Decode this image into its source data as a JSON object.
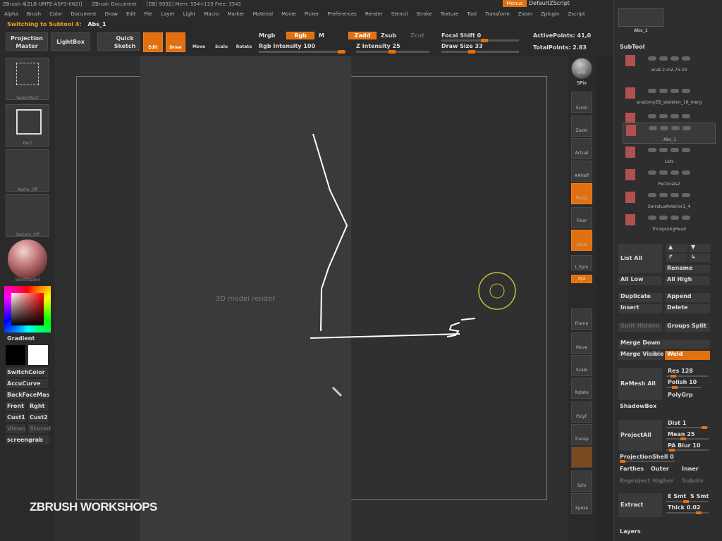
{
  "titlebar": {
    "app": "ZBrush 4[ZLB-UMTE-A5P3-KN2I]",
    "doc": "ZBrush Document",
    "mem": "[DB] 9092] Mem: 554+119 Free: 3541",
    "menus_label": "Menus",
    "script_label": "DefaultZScript"
  },
  "menubar": [
    "Alpha",
    "Brush",
    "Color",
    "Document",
    "Draw",
    "Edit",
    "File",
    "Layer",
    "Light",
    "Macro",
    "Marker",
    "Material",
    "Movie",
    "Picker",
    "Preferences",
    "Render",
    "Stencil",
    "Stroke",
    "Texture",
    "Tool",
    "Transform",
    "Zoom",
    "Zplugin",
    "Zscript"
  ],
  "status": {
    "message": "Switching to Subtool 4:",
    "subtool": "Abs_1"
  },
  "toolbar": {
    "projection_master": "Projection Master",
    "lightbox": "LightBox",
    "quick_sketch": "Quick Sketch",
    "edit": "Edit",
    "draw": "Draw",
    "move": "Move",
    "scale": "Scale",
    "rotate": "Rotate",
    "mrgb": "Mrgb",
    "rgb": "Rgb",
    "m": "M",
    "rgb_intensity": "Rgb Intensity 100",
    "zadd": "Zadd",
    "zsub": "Zsub",
    "zcut": "Zcut",
    "z_intensity": "Z Intensity 25",
    "focal_shift": "Focal Shift 0",
    "draw_size": "Draw Size 33",
    "active_points": "ActivePoints: 41,0",
    "total_points": "TotalPoints: 2.83"
  },
  "left_shelf": {
    "select_rect": "SelectRect",
    "rect": "Rect",
    "alpha_off": "Alpha_Off",
    "texture_off": "Texture_Off",
    "material": "SkinShade4",
    "gradient": "Gradient",
    "switch_color": "SwitchColor",
    "accucurve": "AccuCurve",
    "backfacemask": "BackFaceMas",
    "front": "Front",
    "right": "Rght",
    "cust1": "Cust1",
    "cust2": "Cust2",
    "views": "Views",
    "stored": "Stored",
    "screengrab": "screengrab"
  },
  "canvas": {
    "watermark": "ZBRUSH WORKSHOPS",
    "placeholder": "3D model render"
  },
  "right_shelf": {
    "bpr": "BPR",
    "spix": "SPix",
    "scroll": "Scroll",
    "zoom": "Zoom",
    "actual": "Actual",
    "aahalf": "AAHalf",
    "persp": "Persp",
    "floor": "Floor",
    "local": "Local",
    "lsym": "L.Sym",
    "xyz": "xyz",
    "frame": "Frame",
    "move": "Move",
    "scale": "Scale",
    "rotate": "Rotate",
    "polyf": "PolyF",
    "transp": "Transp",
    "solo": "Solo",
    "xpose": "Xpose"
  },
  "right_panel": {
    "top_thumb_label": "Abs_1",
    "subtool_title": "SubTool",
    "subtools": [
      {
        "name": "anat-2-m2-75-03"
      },
      {
        "name": "anatomyZB_skeleton_16_merg"
      },
      {
        "name": "ExternalOblique"
      },
      {
        "name": "Abs_1"
      },
      {
        "name": "Lats"
      },
      {
        "name": "Pectorals2"
      },
      {
        "name": "SerratusAnterior1_4"
      },
      {
        "name": "TricepLongHead"
      }
    ],
    "list_all": "List All",
    "rename": "Rename",
    "all_low": "All Low",
    "all_high": "All High",
    "duplicate": "Duplicate",
    "append": "Append",
    "insert": "Insert",
    "delete": "Delete",
    "split_hidden": "Split Hidden",
    "groups_split": "Groups Split",
    "merge_down": "Merge Down",
    "merge_visible": "Merge Visible",
    "weld": "Weld",
    "remesh_all": "ReMesh All",
    "res": "Res 128",
    "polish": "Polish 10",
    "polygrp": "PolyGrp",
    "shadowbox": "ShadowBox",
    "projectall": "ProjectAll",
    "dist": "Dist 1",
    "mean": "Mean 25",
    "pa_blur": "PA Blur 10",
    "projection_shell": "ProjectionShell 0",
    "farthest": "Farthes",
    "outer": "Outer",
    "inner": "Inner",
    "reproject_higher": "Reproject Higher",
    "subdiv": "Subdiv",
    "extract": "Extract",
    "e_smt": "E Smt",
    "s_smt": "S Smt",
    "thick": "Thick 0.02",
    "layers": "Layers"
  },
  "colors": {
    "accent": "#e07010",
    "background": "#2a2a2a",
    "canvas": "#303030"
  }
}
